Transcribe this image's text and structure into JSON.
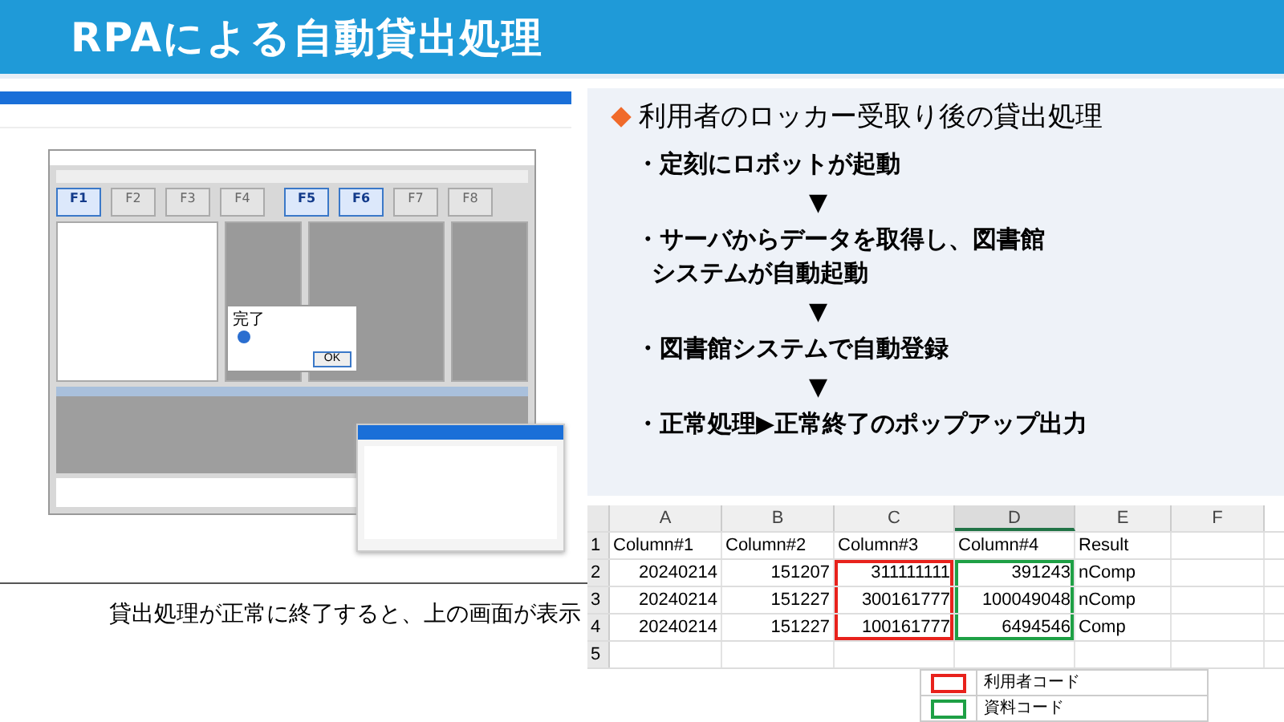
{
  "title": "RPAによる自動貸出処理",
  "screenshot": {
    "function_keys": [
      {
        "label": "F1",
        "selected": true
      },
      {
        "label": "F2",
        "selected": false
      },
      {
        "label": "F3",
        "selected": false
      },
      {
        "label": "F4",
        "selected": false
      },
      {
        "label": "F5",
        "selected": true
      },
      {
        "label": "F6",
        "selected": true
      },
      {
        "label": "F7",
        "selected": false
      },
      {
        "label": "F8",
        "selected": false
      }
    ],
    "dialog": {
      "title": "完了",
      "button": "OK"
    }
  },
  "caption": "貸出処理が正常に終了すると、上の画面が表示",
  "steps": {
    "heading": "利用者のロッカー受取り後の貸出処理",
    "items": [
      {
        "kind": "step",
        "text": "・定刻にロボットが起動"
      },
      {
        "kind": "arrow",
        "text": "▼"
      },
      {
        "kind": "step",
        "lines": [
          "・サーバからデータを取得し、図書館",
          "システムが自動起動"
        ]
      },
      {
        "kind": "arrow",
        "text": "▼"
      },
      {
        "kind": "step",
        "text": "・図書館システムで自動登録"
      },
      {
        "kind": "arrow",
        "text": "▼"
      },
      {
        "kind": "step",
        "text": "・正常処理▶正常終了のポップアップ出力"
      }
    ]
  },
  "sheet": {
    "columns": [
      {
        "label": "A",
        "selected": false
      },
      {
        "label": "B",
        "selected": false
      },
      {
        "label": "C",
        "selected": false,
        "color": "#e8221c"
      },
      {
        "label": "D",
        "selected": true,
        "color": "#1ea045"
      },
      {
        "label": "E",
        "selected": false
      },
      {
        "label": "F",
        "selected": false
      }
    ],
    "rows": [
      {
        "number": "1",
        "cells": [
          "Column#1",
          "Column#2",
          "Column#3",
          "Column#4",
          "Result"
        ]
      },
      {
        "number": "2",
        "cells": [
          "20240214",
          "151207",
          "311111111",
          "391243",
          "nComp"
        ]
      },
      {
        "number": "3",
        "cells": [
          "20240214",
          "151227",
          "300161777",
          "100049048",
          "nComp"
        ]
      },
      {
        "number": "4",
        "cells": [
          "20240214",
          "151227",
          "100161777",
          "6494546",
          "Comp"
        ]
      },
      {
        "number": "5",
        "cells": []
      }
    ],
    "legend": [
      {
        "color": "#e8221c",
        "label": "利用者コード"
      },
      {
        "color": "#1ea045",
        "label": "資料コード"
      }
    ]
  }
}
